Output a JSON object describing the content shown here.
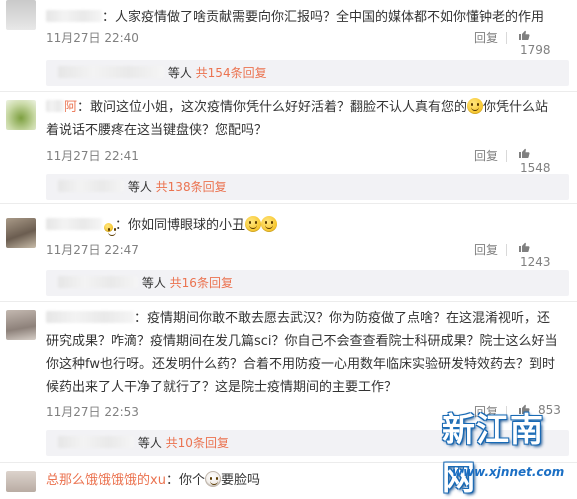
{
  "comments": [
    {
      "text_user_suffix": "：",
      "text": "人家疫情做了啥贡献需要向你汇报吗？全中国的媒体都不如你懂钟老的作用",
      "time": "11月27日 22:40",
      "reply_label": "回复",
      "likes": "1798",
      "sub_tail": "等人",
      "sub_more": "共154条回复"
    },
    {
      "user_tail": "阿",
      "text_a": "：敢问这位小姐，这次疫情你凭什么好好活着？翻脸不认人真有您的",
      "text_b": "你凭什么站着说话不腰疼在这当键盘侠？您配吗？",
      "time": "11月27日 22:41",
      "reply_label": "回复",
      "likes": "1548",
      "sub_tail": "等人",
      "sub_more": "共138条回复"
    },
    {
      "text": "：你如同博眼球的小丑",
      "time": "11月27日 22:47",
      "reply_label": "回复",
      "likes": "1243",
      "sub_tail": "等人",
      "sub_more": "共16条回复"
    },
    {
      "text": "：疫情期间你敢不敢去愿去武汉？你为防疫做了点啥？在这混淆视听，还研究成果？咋滴？疫情期间在发几篇sci？你自己不会查查看院士科研成果？院士这么好当你这种fw也行呀。还发明什么药？合着不用防疫一心用数年临床实验研发特效药去？到时候药出来了人干净了就行了？这是院士疫情期间的主要工作？",
      "time": "11月27日 22:53",
      "reply_label": "回复",
      "likes": "853",
      "sub_tail": "等人",
      "sub_more": "共10条回复"
    },
    {
      "user": "总那么饿饿饿饿的xu",
      "text_a": "：你个",
      "text_b": "要脸吗"
    }
  ],
  "watermark": {
    "title": "新江南网",
    "url": "www.xjnnet.com"
  },
  "colors": {
    "username": "#eb7350",
    "meta": "#808080",
    "subbox_bg": "#f2f2f5",
    "watermark_blue": "#1b6fc4"
  },
  "icons": {
    "like": "thumbs-up-icon",
    "emoji": "smile-emoji-icon",
    "ghost": "ghost-emoji-icon"
  }
}
